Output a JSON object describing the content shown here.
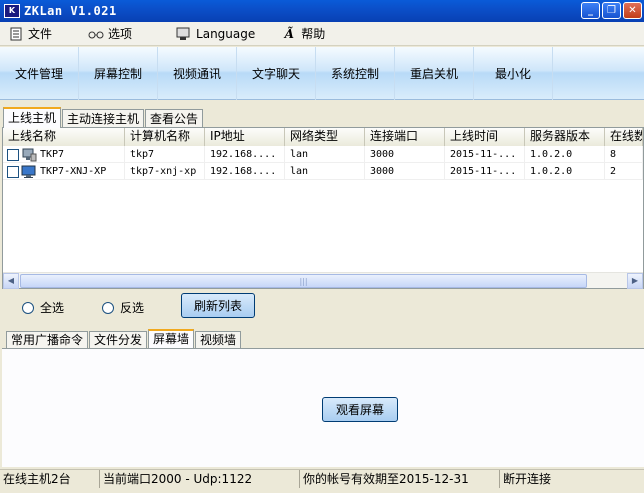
{
  "window": {
    "title": "ZKLan V1.021",
    "icon_text": "K"
  },
  "menu": [
    {
      "label": "文件",
      "icon": "file-menu-icon"
    },
    {
      "label": "选项",
      "icon": "glasses-icon"
    },
    {
      "label": "Language",
      "icon": "language-icon"
    },
    {
      "label": "帮助",
      "icon": "help-icon"
    }
  ],
  "toolbar": {
    "items": [
      "文件管理",
      "屏幕控制",
      "视频通讯",
      "文字聊天",
      "系统控制",
      "重启关机",
      "最小化"
    ]
  },
  "host_tabs": [
    "上线主机",
    "主动连接主机",
    "查看公告"
  ],
  "table": {
    "columns": [
      "上线名称",
      "计算机名称",
      "IP地址",
      "网络类型",
      "连接端口",
      "上线时间",
      "服务器版本",
      "在线数"
    ],
    "rows": [
      [
        "TKP7",
        "tkp7",
        "192.168....",
        "lan",
        "3000",
        "2015-11-...",
        "1.0.2.0",
        "8"
      ],
      [
        "TKP7-XNJ-XP",
        "tkp7-xnj-xp",
        "192.168....",
        "lan",
        "3000",
        "2015-11-...",
        "1.0.2.0",
        "2"
      ]
    ]
  },
  "selection": {
    "select_all": "全选",
    "invert": "反选",
    "refresh": "刷新列表"
  },
  "function_tabs": [
    "常用广播命令",
    "文件分发",
    "屏幕墙",
    "视频墙"
  ],
  "screen_wall": {
    "view_button": "观看屏幕"
  },
  "status": {
    "online": "在线主机2台",
    "port": "当前端口2000 - Udp:1122",
    "expiry": "你的帐号有效期至2015-12-31",
    "connection": "断开连接"
  }
}
